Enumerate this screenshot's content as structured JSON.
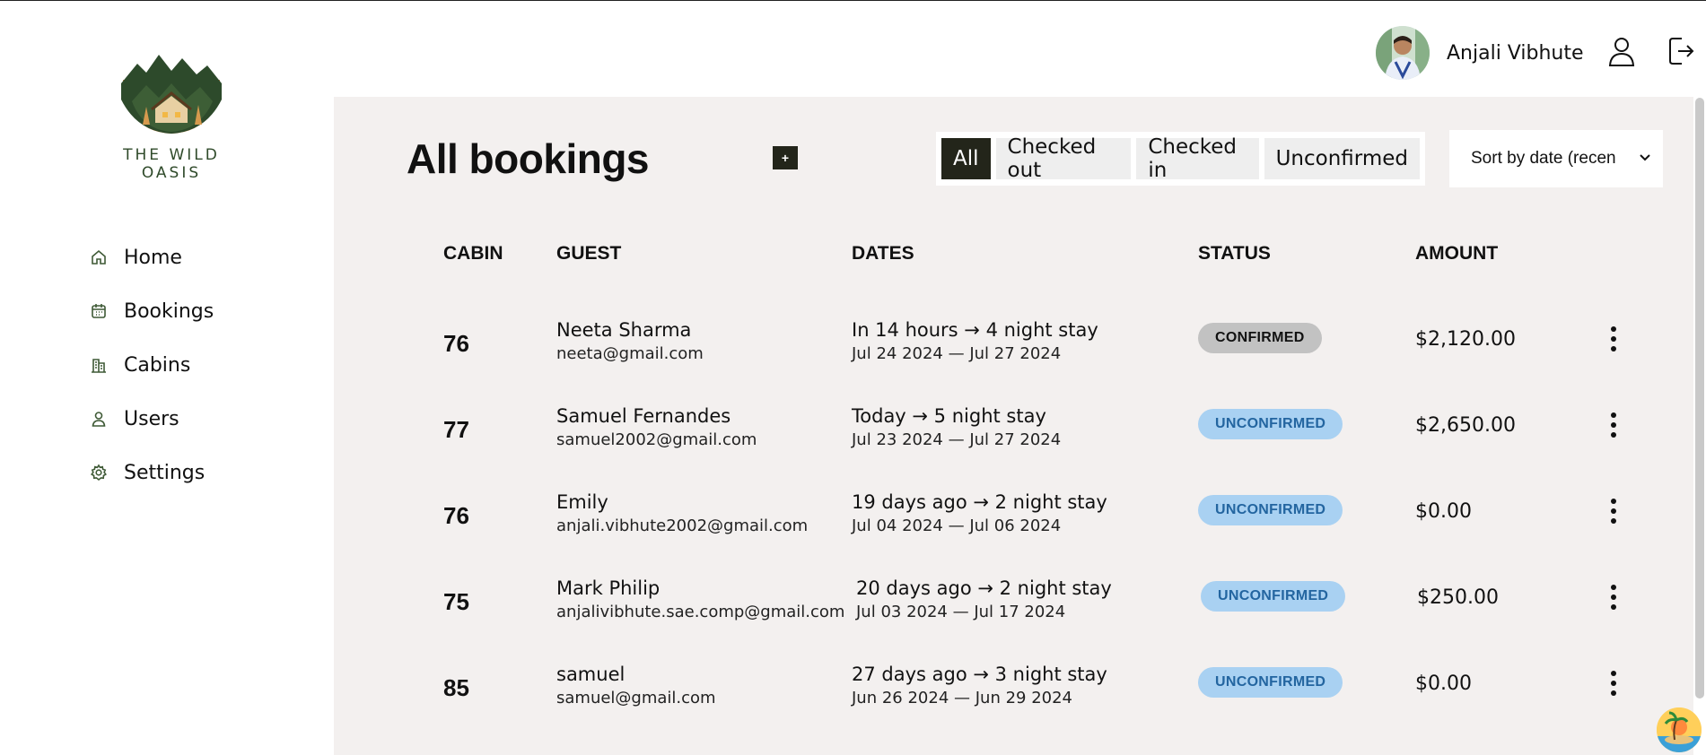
{
  "brand": {
    "name": "THE WILD OASIS"
  },
  "nav": {
    "items": [
      {
        "label": "Home",
        "icon": "home-icon"
      },
      {
        "label": "Bookings",
        "icon": "calendar-icon"
      },
      {
        "label": "Cabins",
        "icon": "building-icon"
      },
      {
        "label": "Users",
        "icon": "user-icon"
      },
      {
        "label": "Settings",
        "icon": "gear-icon"
      }
    ]
  },
  "header": {
    "user_name": "Anjali Vibhute",
    "add_label": "+"
  },
  "main": {
    "title": "All bookings",
    "filters": [
      "All",
      "Checked out",
      "Checked in",
      "Unconfirmed"
    ],
    "active_filter": "All",
    "sort_label": "Sort by date (recen"
  },
  "table": {
    "headers": [
      "CABIN",
      "GUEST",
      "DATES",
      "STATUS",
      "AMOUNT"
    ],
    "rows": [
      {
        "cabin": "76",
        "guest": "Neeta Sharma",
        "email": "neeta@gmail.com",
        "when": "In 14 hours → 4 night stay",
        "range": "Jul 24 2024 — Jul 27 2024",
        "status": "CONFIRMED",
        "amount": "$2,120.00"
      },
      {
        "cabin": "77",
        "guest": "Samuel Fernandes",
        "email": "samuel2002@gmail.com",
        "when": "Today → 5 night stay",
        "range": "Jul 23 2024 — Jul 27 2024",
        "status": "UNCONFIRMED",
        "amount": "$2,650.00"
      },
      {
        "cabin": "76",
        "guest": "Emily",
        "email": "anjali.vibhute2002@gmail.com",
        "when": "19 days ago → 2 night stay",
        "range": "Jul 04 2024 — Jul 06 2024",
        "status": "UNCONFIRMED",
        "amount": "$0.00"
      },
      {
        "cabin": "75",
        "guest": "Mark Philip",
        "email": "anjalivibhute.sae.comp@gmail.com",
        "when": "20 days ago → 2 night stay",
        "range": "Jul 03 2024 — Jul 17 2024",
        "status": "UNCONFIRMED",
        "amount": "$250.00"
      },
      {
        "cabin": "85",
        "guest": "samuel",
        "email": "samuel@gmail.com",
        "when": "27 days ago → 3 night stay",
        "range": "Jun 26 2024 — Jun 29 2024",
        "status": "UNCONFIRMED",
        "amount": "$0.00"
      }
    ]
  },
  "colors": {
    "accent": "#23251a",
    "main_bg": "#f3f0ef",
    "confirmed_bg": "#c2c2c2",
    "unconfirmed_bg": "#a9d1f2",
    "unconfirmed_text": "#2365a0"
  }
}
